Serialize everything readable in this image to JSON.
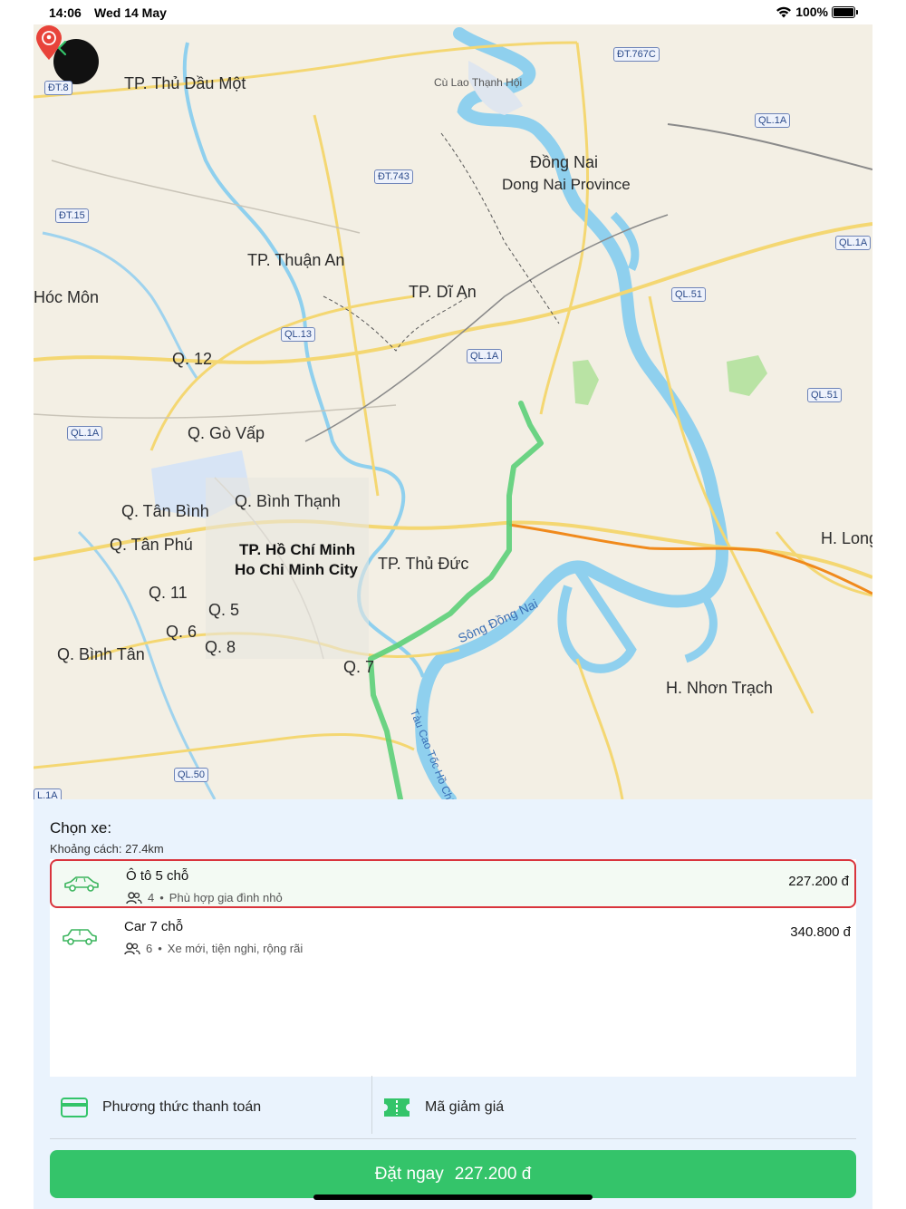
{
  "status_bar": {
    "time": "14:06",
    "date": "Wed 14 May",
    "battery": "100%"
  },
  "map": {
    "labels": {
      "thu_dau_mot": "TP. Thủ Dầu Một",
      "cu_lao_thanh_hoi": "Cù Lao Thạnh Hội",
      "dong_nai": "Đồng Nai",
      "dong_nai_province": "Dong Nai Province",
      "thuan_an": "TP. Thuận An",
      "hoc_mon": "Hóc Môn",
      "di_an": "TP. Dĩ An",
      "q12": "Q. 12",
      "go_vap": "Q. Gò Vấp",
      "binh_thanh": "Q. Bình Thạnh",
      "tan_binh": "Q. Tân Bình",
      "tan_phu": "Q. Tân Phú",
      "hcm_vi": "TP. Hồ Chí Minh",
      "hcm_en": "Ho Chi Minh City",
      "thu_duc": "TP. Thủ Đức",
      "q11": "Q. 11",
      "q5": "Q. 5",
      "q6": "Q. 6",
      "q8": "Q. 8",
      "binh_tan": "Q. Bình Tân",
      "q7": "Q. 7",
      "h_long": "H. Long",
      "nhon_trach": "H. Nhơn Trạch",
      "song_dong_nai": "Sông Đồng Nai",
      "tau_cao_toc": "Tàu Cao Tốc Hồ Chí"
    },
    "shields": {
      "dt8": "ĐT.8",
      "dt767c": "ĐT.767C",
      "ql1a_1": "QL.1A",
      "dt743": "ĐT.743",
      "dt15": "ĐT.15",
      "ql1a_2": "QL.1A",
      "ql51_1": "QL.51",
      "ql13": "QL.13",
      "ql1a_3": "QL.1A",
      "ql51_2": "QL.51",
      "ql1a_4": "QL.1A",
      "ql50": "QL.50",
      "l1a": "L.1A"
    }
  },
  "panel": {
    "title": "Chọn xe:",
    "distance": "Khoảng cách: 27.4km",
    "options": [
      {
        "name": "Ô tô 5 chỗ",
        "seats": "4",
        "description": "Phù hợp gia đình nhỏ",
        "price": "227.200  đ",
        "selected": true
      },
      {
        "name": "Car 7 chỗ",
        "seats": "6",
        "description": "Xe mới, tiện nghi, rộng rãi",
        "price": "340.800  đ",
        "selected": false
      }
    ],
    "payment_label": "Phương thức thanh toán",
    "voucher_label": "Mã giảm giá",
    "book_label": "Đặt ngay",
    "book_price": "227.200 đ"
  },
  "colors": {
    "accent": "#34c46a",
    "selected_border": "#d9343c",
    "water": "#8fd0ee",
    "route": "#5ccf78",
    "highway": "#f08a1c"
  }
}
